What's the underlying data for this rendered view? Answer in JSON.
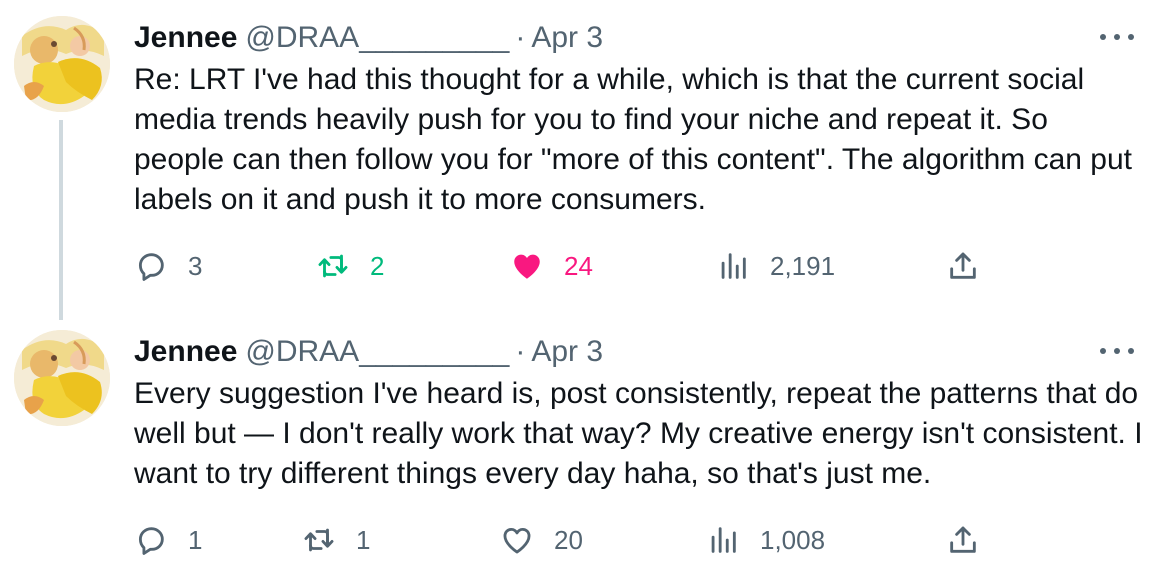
{
  "colors": {
    "text_primary": "#0f1419",
    "text_secondary": "#536471",
    "retweet_active": "#00ba7c",
    "like_active": "#f91880",
    "thread_line": "#cfd9de"
  },
  "tweets": [
    {
      "author_name": "Jennee",
      "handle": "@DRAA_________",
      "separator": "·",
      "date": "Apr 3",
      "text": "Re: LRT I've had this thought for a while, which is that the current social media trends heavily push for you to find your niche and repeat it. So people can then follow you for \"more of this content\". The algorithm can put labels on it and push it to more consumers.",
      "replies": "3",
      "retweets": "2",
      "likes": "24",
      "views": "2,191",
      "retweeted": true,
      "liked": true,
      "icons": [
        "reply-icon",
        "retweet-icon",
        "heart-filled-icon",
        "views-icon",
        "share-icon",
        "more-icon"
      ]
    },
    {
      "author_name": "Jennee",
      "handle": "@DRAA_________",
      "separator": "·",
      "date": "Apr 3",
      "text": "Every suggestion I've heard is, post consistently, repeat the patterns that do well but — I don't really work that way? My creative energy isn't consistent. I want to try different things every day haha, so that's just me.",
      "replies": "1",
      "retweets": "1",
      "likes": "20",
      "views": "1,008",
      "retweeted": false,
      "liked": false,
      "icons": [
        "reply-icon",
        "retweet-icon",
        "heart-outline-icon",
        "views-icon",
        "share-icon",
        "more-icon"
      ]
    }
  ]
}
